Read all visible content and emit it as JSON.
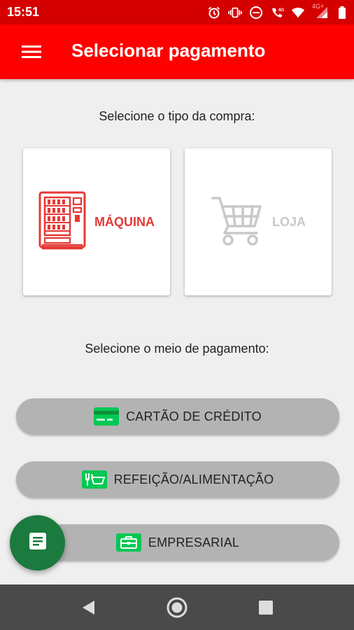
{
  "status_bar": {
    "time": "15:51",
    "network_label": "4G+",
    "icons": [
      "alarm-icon",
      "vibrate-icon",
      "do-not-disturb-icon",
      "volte-icon",
      "wifi-icon",
      "signal-icon",
      "battery-icon"
    ]
  },
  "app_bar": {
    "title": "Selecionar pagamento",
    "menu_icon": "hamburger-menu-icon"
  },
  "purchase_type": {
    "prompt": "Selecione o tipo da compra:",
    "options": [
      {
        "label": "MÁQUINA",
        "icon": "vending-machine-icon",
        "selected": true,
        "color": "#e53935"
      },
      {
        "label": "LOJA",
        "icon": "shopping-cart-icon",
        "selected": false,
        "color": "#c8c8c8"
      }
    ]
  },
  "payment_method": {
    "prompt": "Selecione o meio de pagamento:",
    "options": [
      {
        "label": "CARTÃO DE CRÉDITO",
        "icon": "credit-card-icon"
      },
      {
        "label": "REFEIÇÃO/ALIMENTAÇÃO",
        "icon": "food-basket-icon"
      },
      {
        "label": "EMPRESARIAL",
        "icon": "briefcase-icon"
      }
    ]
  },
  "fab": {
    "icon": "document-icon"
  },
  "nav_bar": {
    "icons": [
      "back-icon",
      "home-icon",
      "recents-icon"
    ]
  },
  "colors": {
    "status_bar": "#d50000",
    "app_bar": "#ff0000",
    "accent_red": "#e53935",
    "disabled_gray": "#c8c8c8",
    "pill_bg": "#b3b3b3",
    "icon_green": "#00c853",
    "fab_green": "#1b7a3e",
    "nav_bar": "#4a4a4a"
  }
}
